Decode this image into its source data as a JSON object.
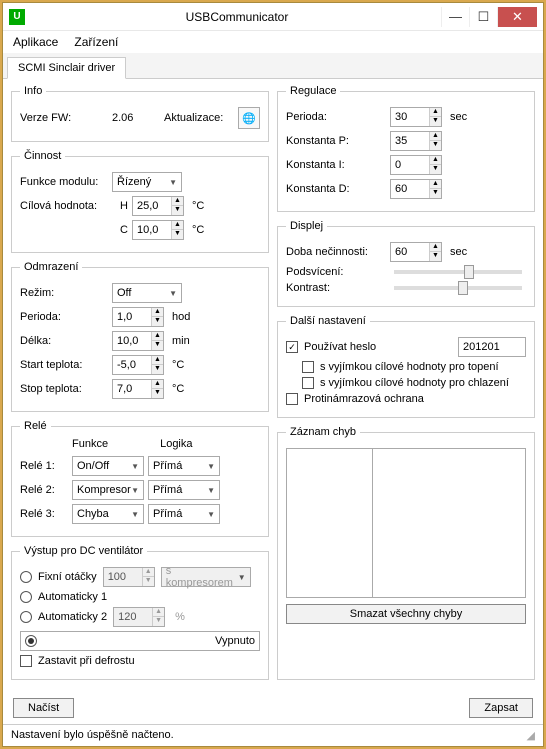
{
  "window": {
    "title": "USBCommunicator"
  },
  "menu": {
    "app": "Aplikace",
    "device": "Zařízení"
  },
  "tab": {
    "label": "SCMI Sinclair driver"
  },
  "info": {
    "legend": "Info",
    "fw_label": "Verze FW:",
    "fw_value": "2.06",
    "update_label": "Aktualizace:"
  },
  "cinnost": {
    "legend": "Činnost",
    "mode_label": "Funkce modulu:",
    "mode_value": "Řízený",
    "target_label": "Cílová hodnota:",
    "h_mark": "H",
    "h_val": "25,0",
    "h_unit": "°C",
    "c_mark": "C",
    "c_val": "10,0",
    "c_unit": "°C"
  },
  "defrost": {
    "legend": "Odmrazení",
    "rezim_label": "Režim:",
    "rezim_val": "Off",
    "period_label": "Perioda:",
    "period_val": "1,0",
    "period_unit": "hod",
    "len_label": "Délka:",
    "len_val": "10,0",
    "len_unit": "min",
    "start_label": "Start teplota:",
    "start_val": "-5,0",
    "start_unit": "°C",
    "stop_label": "Stop teplota:",
    "stop_val": "7,0",
    "stop_unit": "°C"
  },
  "relay": {
    "legend": "Relé",
    "hdr_func": "Funkce",
    "hdr_logic": "Logika",
    "r1_label": "Relé 1:",
    "r1_func": "On/Off",
    "r1_logic": "Přímá",
    "r2_label": "Relé 2:",
    "r2_func": "Kompresor",
    "r2_logic": "Přímá",
    "r3_label": "Relé 3:",
    "r3_func": "Chyba",
    "r3_logic": "Přímá"
  },
  "fan": {
    "legend": "Výstup pro DC ventilátor",
    "fix_label": "Fixní otáčky",
    "fix_val": "100",
    "fix_mode": "s kompresorem",
    "auto1_label": "Automaticky 1",
    "auto2_label": "Automaticky 2",
    "auto2_val": "120",
    "auto2_unit": "%",
    "off_label": "Vypnuto",
    "stop_defrost_label": "Zastavit při defrostu"
  },
  "reg": {
    "legend": "Regulace",
    "period_label": "Perioda:",
    "period_val": "30",
    "period_unit": "sec",
    "kp_label": "Konstanta P:",
    "kp_val": "35",
    "ki_label": "Konstanta I:",
    "ki_val": "0",
    "kd_label": "Konstanta D:",
    "kd_val": "60"
  },
  "disp": {
    "legend": "Displej",
    "idle_label": "Doba nečinnosti:",
    "idle_val": "60",
    "idle_unit": "sec",
    "backlight_label": "Podsvícení:",
    "contrast_label": "Kontrast:"
  },
  "other": {
    "legend": "Další nastavení",
    "pwd_label": "Používat heslo",
    "pwd_val": "201201",
    "except_heat": "s vyjímkou cílové hodnoty pro topení",
    "except_cool": "s vyjímkou cílové hodnoty pro chlazení",
    "antifrost": "Protinámrazová ochrana"
  },
  "errors": {
    "legend": "Záznam chyb",
    "clear_btn": "Smazat všechny chyby"
  },
  "actions": {
    "load": "Načíst",
    "save": "Zapsat"
  },
  "status": "Nastavení bylo úspěšně načteno."
}
